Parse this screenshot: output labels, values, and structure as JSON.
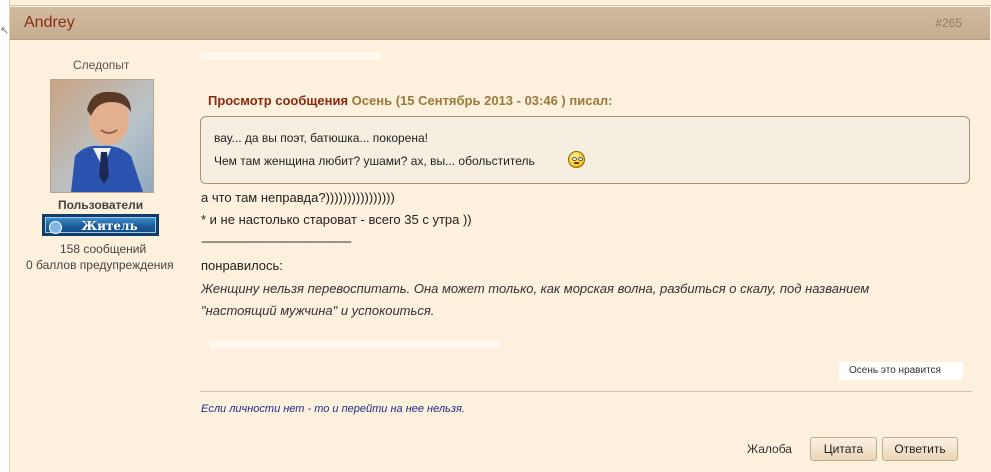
{
  "post": {
    "author": "Andrey",
    "number": "#265"
  },
  "profile": {
    "rank_title": "Следопыт",
    "avatar_icon": "user-avatar-photo",
    "group": "Пользователи",
    "rank_badge": "Житель",
    "message_count": "158 сообщений",
    "warning_points": "0 баллов предупреждения"
  },
  "quote": {
    "label": "Просмотр сообщения",
    "attribution": "Осень (15 Сентябрь 2013 - 03:46 ) писал:",
    "lines": [
      "вау... да вы поэт, батюшка... покорена!",
      "Чем там женщина любит? ушами? ах, вы... обольститель"
    ],
    "emoticon": "smiley-icon"
  },
  "body": {
    "lines": [
      "а что там неправда?))))))))))))))))",
      "* и не настолько староват - всего 35 с утра ))",
      "--------------------------------------------------",
      "понравилось:"
    ],
    "italic_lines": [
      "Женщину нельзя перевоспитать. Она может только, как морская волна, разбиться о скалу, под названием",
      "\"настоящий мужчина\" и успокоиться."
    ]
  },
  "likes": {
    "text": "Осень это нравится"
  },
  "signature": "Если личности нет - то и перейти на нее нельзя.",
  "actions": {
    "report": "Жалоба",
    "quote": "Цитата",
    "reply": "Ответить"
  },
  "colors": {
    "page_bg": "#fdf0dd",
    "header_bg": "#c9b398",
    "author": "#8a2a12",
    "signature": "#1f2c88",
    "badge_bg": "#1d5d99"
  }
}
